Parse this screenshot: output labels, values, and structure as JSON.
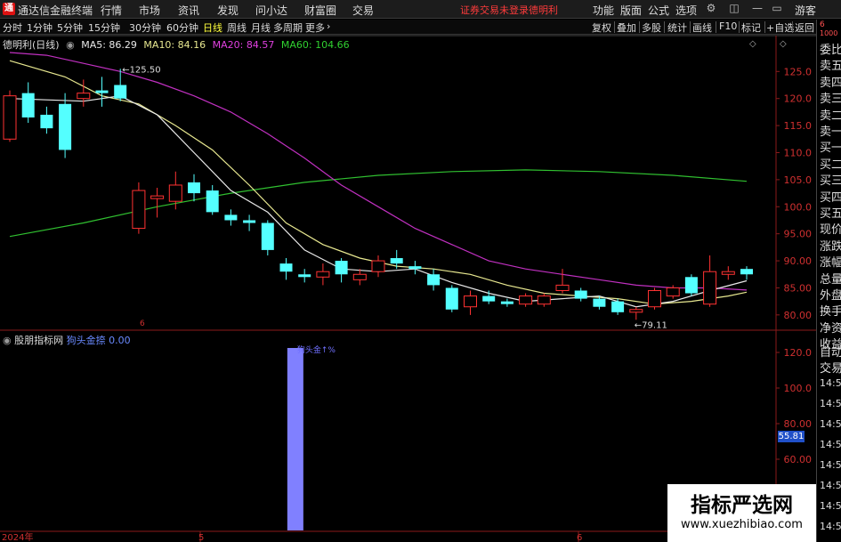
{
  "app": {
    "logo": "通",
    "title": "通达信金融终端",
    "menus": [
      "行情",
      "市场",
      "资讯",
      "发现",
      "问小达",
      "财富圈",
      "交易"
    ],
    "login_status": "证券交易未登录",
    "account": "德明利",
    "right_menus": [
      "功能",
      "版面",
      "公式",
      "选项"
    ],
    "guest": "游客"
  },
  "toolbar": {
    "periods": [
      "分时",
      "1分钟",
      "5分钟",
      "15分钟",
      "30分钟",
      "60分钟",
      "日线",
      "周线",
      "月线",
      "多周期",
      "更多"
    ],
    "active_period": "日线",
    "tools": [
      "复权",
      "叠加",
      "多股",
      "统计",
      "画线",
      "F10",
      "标记",
      "+自选",
      "返回"
    ]
  },
  "stock": {
    "name": "德明利(日线)",
    "ma": [
      {
        "label": "MA5: 86.29",
        "color": "#e8e8e8"
      },
      {
        "label": "MA10: 84.16",
        "color": "#e8e890"
      },
      {
        "label": "MA20: 84.57",
        "color": "#e040e0"
      },
      {
        "label": "MA60: 104.66",
        "color": "#30d030"
      }
    ],
    "high_mark": "125.50",
    "low_mark": "79.11",
    "y_ticks": [
      "125.0",
      "120.0",
      "115.0",
      "110.0",
      "105.0",
      "100.0",
      "95.00",
      "90.00",
      "85.00",
      "80.00"
    ],
    "month_markers": [
      "6"
    ]
  },
  "indicator": {
    "name": "股朋指标网",
    "series": "狗头金捺",
    "value": "0.00",
    "bar_label": "狗头金↑%",
    "y_ticks": [
      "120.0",
      "100.0",
      "80.00",
      "60.00",
      "40.00"
    ],
    "current_box": "55.81"
  },
  "x_axis": [
    "2024年",
    "5",
    "6"
  ],
  "right_panel": {
    "labels": [
      "委比",
      "卖五",
      "卖四",
      "卖三",
      "卖二",
      "卖一",
      "买一",
      "买二",
      "买三",
      "买四",
      "买五",
      "现价",
      "涨跌",
      "涨幅",
      "总量",
      "外盘",
      "换手",
      "净资",
      "收益",
      "自动",
      "交易"
    ],
    "times": [
      "14:5",
      "14:5",
      "14:5",
      "14:5",
      "14:5",
      "14:5",
      "14:5",
      "14:5"
    ],
    "top_numbers": [
      "6",
      "1000"
    ]
  },
  "watermark": {
    "title": "指标严选网",
    "url": "www.xuezhibiao.com"
  },
  "chart_data": {
    "type": "candlestick",
    "price_range": [
      78,
      129
    ],
    "candles": [
      {
        "o": 112.5,
        "c": 120.5,
        "h": 121.5,
        "l": 112.0
      },
      {
        "o": 121.0,
        "c": 116.5,
        "h": 123.0,
        "l": 115.5
      },
      {
        "o": 117.0,
        "c": 114.5,
        "h": 118.5,
        "l": 113.5
      },
      {
        "o": 119.0,
        "c": 110.5,
        "h": 121.0,
        "l": 109.0
      },
      {
        "o": 120.0,
        "c": 121.0,
        "h": 123.5,
        "l": 118.5
      },
      {
        "o": 121.5,
        "c": 121.0,
        "h": 124.0,
        "l": 118.5
      },
      {
        "o": 122.5,
        "c": 120.0,
        "h": 125.5,
        "l": 119.5
      },
      {
        "o": 96.0,
        "c": 103.0,
        "h": 104.5,
        "l": 95.0
      },
      {
        "o": 101.5,
        "c": 102.0,
        "h": 103.5,
        "l": 98.0
      },
      {
        "o": 101.0,
        "c": 104.0,
        "h": 106.5,
        "l": 99.5
      },
      {
        "o": 104.5,
        "c": 102.5,
        "h": 106.0,
        "l": 101.0
      },
      {
        "o": 103.0,
        "c": 99.0,
        "h": 104.0,
        "l": 98.5
      },
      {
        "o": 98.5,
        "c": 97.5,
        "h": 99.5,
        "l": 96.5
      },
      {
        "o": 97.5,
        "c": 97.0,
        "h": 98.5,
        "l": 95.5
      },
      {
        "o": 97.0,
        "c": 92.0,
        "h": 97.5,
        "l": 91.0
      },
      {
        "o": 89.5,
        "c": 88.0,
        "h": 90.5,
        "l": 86.5
      },
      {
        "o": 87.5,
        "c": 87.0,
        "h": 88.5,
        "l": 86.0
      },
      {
        "o": 87.0,
        "c": 88.0,
        "h": 89.5,
        "l": 85.5
      },
      {
        "o": 90.0,
        "c": 87.5,
        "h": 90.5,
        "l": 86.0
      },
      {
        "o": 86.5,
        "c": 87.5,
        "h": 88.5,
        "l": 85.5
      },
      {
        "o": 88.0,
        "c": 90.0,
        "h": 91.0,
        "l": 87.0
      },
      {
        "o": 90.5,
        "c": 89.5,
        "h": 92.0,
        "l": 88.5
      },
      {
        "o": 89.0,
        "c": 88.5,
        "h": 90.0,
        "l": 87.5
      },
      {
        "o": 87.5,
        "c": 85.5,
        "h": 88.5,
        "l": 84.5
      },
      {
        "o": 85.0,
        "c": 81.0,
        "h": 85.5,
        "l": 80.5
      },
      {
        "o": 81.5,
        "c": 83.5,
        "h": 84.5,
        "l": 80.0
      },
      {
        "o": 83.5,
        "c": 82.5,
        "h": 84.5,
        "l": 82.0
      },
      {
        "o": 82.5,
        "c": 82.0,
        "h": 83.0,
        "l": 81.5
      },
      {
        "o": 82.0,
        "c": 83.5,
        "h": 84.0,
        "l": 81.5
      },
      {
        "o": 82.0,
        "c": 83.5,
        "h": 84.0,
        "l": 81.5
      },
      {
        "o": 84.5,
        "c": 85.5,
        "h": 88.5,
        "l": 84.0
      },
      {
        "o": 84.5,
        "c": 83.0,
        "h": 85.0,
        "l": 82.5
      },
      {
        "o": 83.0,
        "c": 81.5,
        "h": 83.5,
        "l": 81.0
      },
      {
        "o": 82.5,
        "c": 80.5,
        "h": 83.0,
        "l": 80.0
      },
      {
        "o": 80.5,
        "c": 81.0,
        "h": 81.5,
        "l": 79.1
      },
      {
        "o": 81.5,
        "c": 84.5,
        "h": 85.0,
        "l": 81.0
      },
      {
        "o": 83.5,
        "c": 85.0,
        "h": 85.5,
        "l": 83.0
      },
      {
        "o": 87.0,
        "c": 84.0,
        "h": 87.5,
        "l": 83.5
      },
      {
        "o": 82.0,
        "c": 88.0,
        "h": 91.0,
        "l": 81.5
      },
      {
        "o": 87.5,
        "c": 88.0,
        "h": 89.0,
        "l": 86.5
      },
      {
        "o": 88.5,
        "c": 87.5,
        "h": 89.0,
        "l": 86.5
      }
    ],
    "ma5": [
      [
        0,
        120.0
      ],
      [
        4,
        119.5
      ],
      [
        6,
        120.5
      ],
      [
        8,
        117.0
      ],
      [
        10,
        110.0
      ],
      [
        12,
        103.0
      ],
      [
        14,
        99.0
      ],
      [
        16,
        92.0
      ],
      [
        18,
        88.5
      ],
      [
        20,
        88.0
      ],
      [
        22,
        88.5
      ],
      [
        24,
        86.0
      ],
      [
        26,
        84.0
      ],
      [
        28,
        82.5
      ],
      [
        30,
        83.0
      ],
      [
        32,
        83.5
      ],
      [
        34,
        81.5
      ],
      [
        36,
        82.5
      ],
      [
        38,
        84.5
      ],
      [
        40,
        86.3
      ]
    ],
    "ma10": [
      [
        0,
        127.0
      ],
      [
        3,
        124.0
      ],
      [
        5,
        120.5
      ],
      [
        7,
        119.0
      ],
      [
        9,
        115.0
      ],
      [
        11,
        110.5
      ],
      [
        13,
        104.0
      ],
      [
        15,
        97.0
      ],
      [
        17,
        93.0
      ],
      [
        19,
        90.5
      ],
      [
        21,
        89.0
      ],
      [
        23,
        88.5
      ],
      [
        25,
        87.5
      ],
      [
        27,
        85.5
      ],
      [
        29,
        84.0
      ],
      [
        31,
        83.5
      ],
      [
        33,
        83.0
      ],
      [
        35,
        82.0
      ],
      [
        37,
        82.5
      ],
      [
        39,
        83.5
      ],
      [
        40,
        84.2
      ]
    ],
    "ma20": [
      [
        0,
        128.5
      ],
      [
        2,
        128.0
      ],
      [
        4,
        126.5
      ],
      [
        6,
        125.0
      ],
      [
        8,
        123.0
      ],
      [
        10,
        120.5
      ],
      [
        12,
        117.5
      ],
      [
        14,
        113.5
      ],
      [
        16,
        109.0
      ],
      [
        18,
        104.0
      ],
      [
        20,
        100.0
      ],
      [
        22,
        96.0
      ],
      [
        24,
        93.0
      ],
      [
        26,
        90.0
      ],
      [
        28,
        88.5
      ],
      [
        30,
        87.5
      ],
      [
        32,
        86.5
      ],
      [
        34,
        85.5
      ],
      [
        36,
        85.0
      ],
      [
        38,
        85.0
      ],
      [
        40,
        84.6
      ]
    ],
    "ma60": [
      [
        0,
        94.5
      ],
      [
        4,
        97.0
      ],
      [
        8,
        100.0
      ],
      [
        12,
        102.5
      ],
      [
        16,
        104.5
      ],
      [
        20,
        105.8
      ],
      [
        24,
        106.5
      ],
      [
        28,
        106.8
      ],
      [
        32,
        106.5
      ],
      [
        36,
        105.8
      ],
      [
        40,
        104.7
      ]
    ],
    "indicator_bars": [
      {
        "index": 15.5,
        "value": 120
      }
    ]
  }
}
